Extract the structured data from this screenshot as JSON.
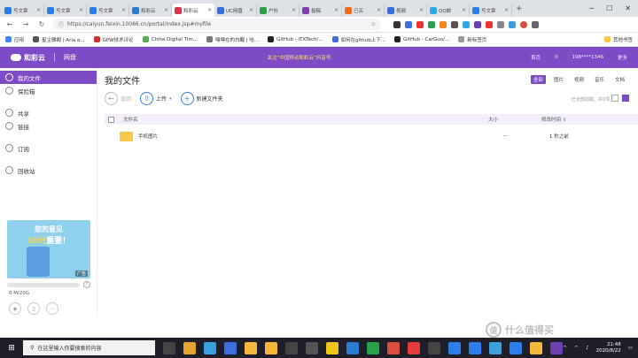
{
  "browser": {
    "tabs": [
      {
        "label": "写文章",
        "color": "#2b7de9"
      },
      {
        "label": "写文章",
        "color": "#2b7de9"
      },
      {
        "label": "写文章",
        "color": "#2b7de9"
      },
      {
        "label": "和彩云",
        "color": "#2e7bd6"
      },
      {
        "label": "和彩云",
        "color": "#d9314a",
        "active": true
      },
      {
        "label": "UC网盘",
        "color": "#3b6ee0"
      },
      {
        "label": "户外",
        "color": "#2aa048"
      },
      {
        "label": "投稿",
        "color": "#7c3fb0"
      },
      {
        "label": "已买",
        "color": "#ee6a1c"
      },
      {
        "label": "视频",
        "color": "#3b6ee0"
      },
      {
        "label": "QQ邮",
        "color": "#2fa8e6"
      },
      {
        "label": "写文章",
        "color": "#2b7de9"
      }
    ],
    "new_tab_symbol": "+",
    "url": "https://caiyun.feixin.10086.cn/portal/index.jsp#myfile",
    "bookmarks": [
      {
        "label": "应用",
        "color": "#4285f4"
      },
      {
        "label": "星尘雅阁 | Aria o...",
        "color": "#555"
      },
      {
        "label": "GPW技术评论",
        "color": "#c33"
      },
      {
        "label": "China Digital Tim...",
        "color": "#5a5"
      },
      {
        "label": "嘿嘿在的白醒 | 哇...",
        "color": "#777"
      },
      {
        "label": "GitHub - iTXTech/...",
        "color": "#222"
      },
      {
        "label": "如何在github上下...",
        "color": "#3b6ee0"
      },
      {
        "label": "GitHub - CarGuo/...",
        "color": "#222"
      },
      {
        "label": "新标签页",
        "color": "#999"
      }
    ],
    "other_bookmarks": "其他书签"
  },
  "app": {
    "logo": "和彩云",
    "product": "网盘",
    "notice": "关注“中国移动和彩云”抖音号",
    "header_links": [
      "首页",
      "0",
      "198****1346",
      "更多"
    ]
  },
  "sidebar": {
    "items": [
      {
        "label": "我的文件",
        "active": true
      },
      {
        "label": "保险箱"
      },
      {
        "label": "共享"
      },
      {
        "label": "链接"
      },
      {
        "label": "订阅"
      },
      {
        "label": "回收站"
      }
    ],
    "ad": {
      "line1": "您的意见",
      "line2_a": "10分",
      "line2_b": "重要！",
      "tag": "广告"
    },
    "storage": "0 M/20G",
    "help_symbol": "?",
    "device_icons": [
      "android-icon",
      "phone-icon",
      "more-icon"
    ]
  },
  "content": {
    "title": "我的文件",
    "filters": [
      {
        "label": "全部",
        "active": true
      },
      {
        "label": "图片"
      },
      {
        "label": "视频"
      },
      {
        "label": "音乐"
      },
      {
        "label": "文档"
      }
    ],
    "back": "返回",
    "upload": "上传",
    "new_folder": "新建文件夹",
    "loaded_info": "已全部加载，共1项",
    "columns": {
      "name": "文件名",
      "size": "大小",
      "time": "修改时间"
    },
    "files": [
      {
        "name": "手机图片",
        "size": "--",
        "time": "1 秒之前"
      }
    ]
  },
  "taskbar": {
    "search_placeholder": "在这里输入你要搜索的内容",
    "time": "21:48",
    "date": "2020/8/22",
    "app_colors": [
      "#444",
      "#e5a42d",
      "#3aa0e0",
      "#3b6ee0",
      "#f6b73c",
      "#f6b73c",
      "#444",
      "#555",
      "#f0c419",
      "#2a7bd4",
      "#2aa048",
      "#d94f3a",
      "#e63939",
      "#444",
      "#2b7de9",
      "#2b7de9",
      "#3aa0e0",
      "#2b7de9",
      "#f6b73c",
      "#6b3fb0"
    ]
  },
  "watermark": {
    "badge": "值",
    "text": "什么值得买"
  }
}
